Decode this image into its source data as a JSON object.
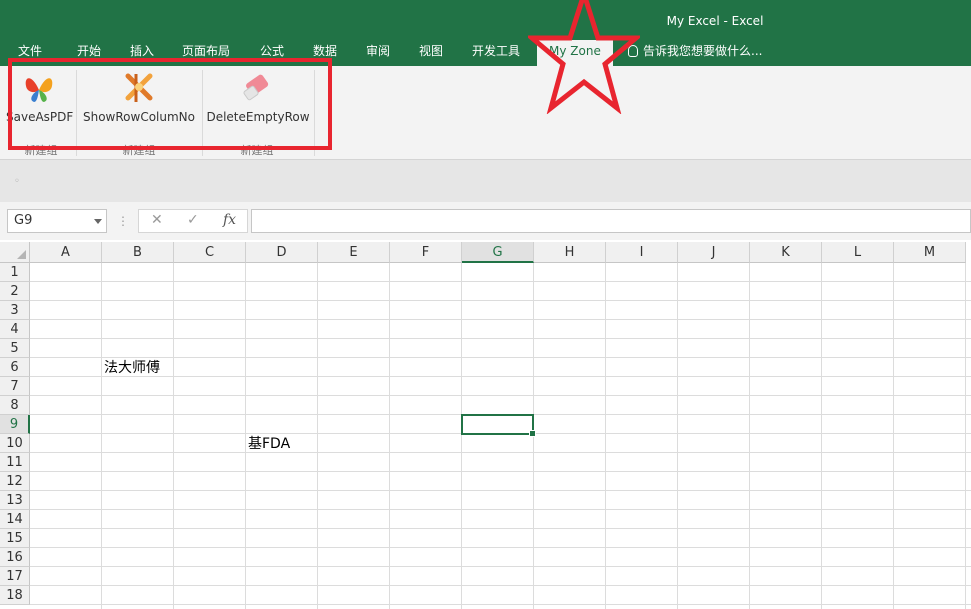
{
  "window": {
    "title": "My Excel - Excel"
  },
  "tabs": [
    "文件",
    "开始",
    "插入",
    "页面布局",
    "公式",
    "数据",
    "审阅",
    "视图",
    "开发工具",
    "My Zone"
  ],
  "tell_me": "告诉我您想要做什么...",
  "ribbon": {
    "buttons": [
      {
        "label": "SaveAsPDF",
        "icon": "butterfly-icon",
        "group": "新建组"
      },
      {
        "label": "ShowRowColumNo",
        "icon": "crossed-arrows-icon",
        "group": "新建组"
      },
      {
        "label": "DeleteEmptyRow",
        "icon": "eraser-icon",
        "group": "新建组"
      }
    ]
  },
  "formula_bar": {
    "name_box": "G9",
    "fx": "fx",
    "value": ""
  },
  "sheet": {
    "columns": [
      "A",
      "B",
      "C",
      "D",
      "E",
      "F",
      "G",
      "H",
      "I",
      "J",
      "K",
      "L",
      "M"
    ],
    "rows": [
      "1",
      "2",
      "3",
      "4",
      "5",
      "6",
      "7",
      "8",
      "9",
      "10",
      "11",
      "12",
      "13",
      "14",
      "15",
      "16",
      "17",
      "18"
    ],
    "selected_cell": "G9",
    "cells": [
      {
        "ref": "B6",
        "value": "法大师傅"
      },
      {
        "ref": "D10",
        "value": "基FDA"
      }
    ]
  },
  "colors": {
    "excel_green": "#217346",
    "annotation_red": "#e8252f"
  }
}
